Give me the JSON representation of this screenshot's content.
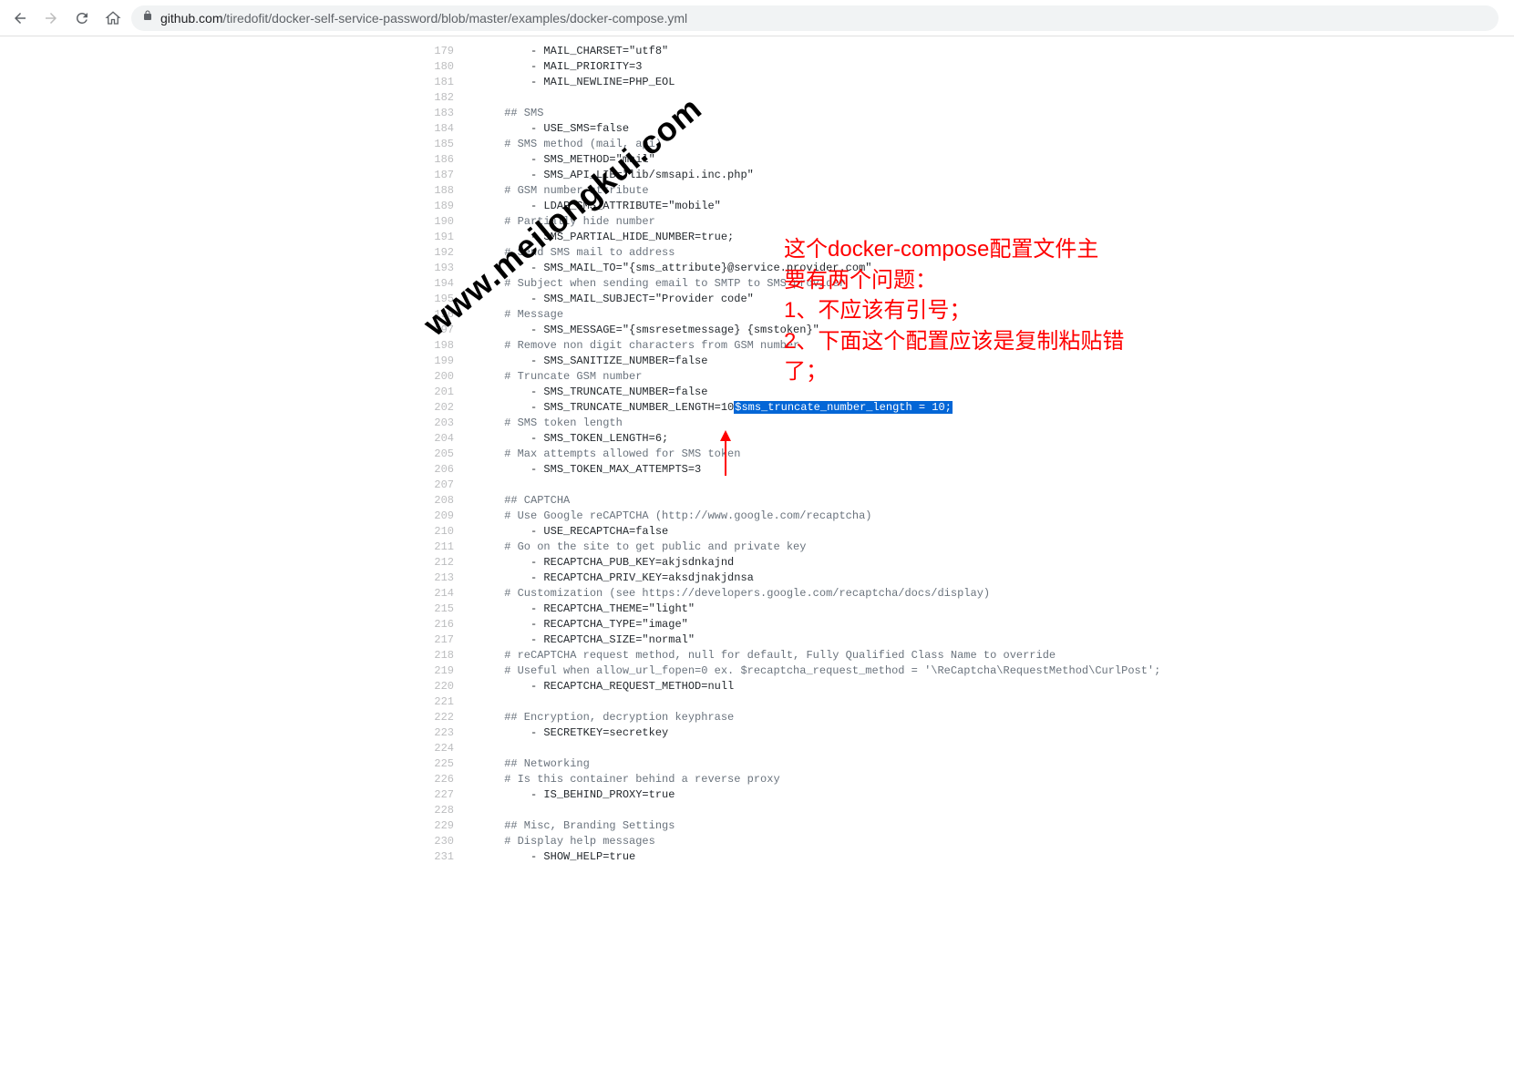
{
  "browser": {
    "url_domain": "github.com",
    "url_path": "/tiredofit/docker-self-service-password/blob/master/examples/docker-compose.yml"
  },
  "annotation": {
    "line1": "这个docker-compose配置文件主",
    "line2": "要有两个问题：",
    "line3": "1、不应该有引号；",
    "line4": "2、下面这个配置应该是复制粘贴错",
    "line5": "了；"
  },
  "watermark": "www.meilongkui.com",
  "code_lines": [
    {
      "n": 179,
      "indent": 10,
      "type": "plain",
      "text": "- MAIL_CHARSET=\"utf8\""
    },
    {
      "n": 180,
      "indent": 10,
      "type": "plain",
      "text": "- MAIL_PRIORITY=3"
    },
    {
      "n": 181,
      "indent": 10,
      "type": "plain",
      "text": "- MAIL_NEWLINE=PHP_EOL"
    },
    {
      "n": 182,
      "indent": 0,
      "type": "blank",
      "text": ""
    },
    {
      "n": 183,
      "indent": 6,
      "type": "comment",
      "text": "## SMS"
    },
    {
      "n": 184,
      "indent": 10,
      "type": "plain",
      "text": "- USE_SMS=false"
    },
    {
      "n": 185,
      "indent": 6,
      "type": "comment",
      "text": "# SMS method (mail, api)"
    },
    {
      "n": 186,
      "indent": 10,
      "type": "plain",
      "text": "- SMS_METHOD=\"mail\""
    },
    {
      "n": 187,
      "indent": 10,
      "type": "plain",
      "text": "- SMS_API_LIB=\"lib/smsapi.inc.php\""
    },
    {
      "n": 188,
      "indent": 6,
      "type": "comment",
      "text": "# GSM number attribute"
    },
    {
      "n": 189,
      "indent": 10,
      "type": "plain",
      "text": "- LDAP_SMS_ATTRIBUTE=\"mobile\""
    },
    {
      "n": 190,
      "indent": 6,
      "type": "comment",
      "text": "# Partially hide number"
    },
    {
      "n": 191,
      "indent": 10,
      "type": "plain",
      "text": "- SMS_PARTIAL_HIDE_NUMBER=true;"
    },
    {
      "n": 192,
      "indent": 6,
      "type": "comment",
      "text": "# Send SMS mail to address"
    },
    {
      "n": 193,
      "indent": 10,
      "type": "plain",
      "text": "- SMS_MAIL_TO=\"{sms_attribute}@service.provider.com\""
    },
    {
      "n": 194,
      "indent": 6,
      "type": "comment",
      "text": "# Subject when sending email to SMTP to SMS provider"
    },
    {
      "n": 195,
      "indent": 10,
      "type": "plain",
      "text": "- SMS_MAIL_SUBJECT=\"Provider code\""
    },
    {
      "n": 196,
      "indent": 6,
      "type": "comment",
      "text": "# Message"
    },
    {
      "n": 197,
      "indent": 10,
      "type": "plain",
      "text": "- SMS_MESSAGE=\"{smsresetmessage} {smstoken}\""
    },
    {
      "n": 198,
      "indent": 6,
      "type": "comment",
      "text": "# Remove non digit characters from GSM number"
    },
    {
      "n": 199,
      "indent": 10,
      "type": "plain",
      "text": "- SMS_SANITIZE_NUMBER=false"
    },
    {
      "n": 200,
      "indent": 6,
      "type": "comment",
      "text": "# Truncate GSM number"
    },
    {
      "n": 201,
      "indent": 10,
      "type": "plain",
      "text": "- SMS_TRUNCATE_NUMBER=false"
    },
    {
      "n": 202,
      "indent": 10,
      "type": "plain",
      "text": "- SMS_TRUNCATE_NUMBER_LENGTH=10",
      "hl": "$sms_truncate_number_length = 10;"
    },
    {
      "n": 203,
      "indent": 6,
      "type": "comment",
      "text": "# SMS token length"
    },
    {
      "n": 204,
      "indent": 10,
      "type": "plain",
      "text": "- SMS_TOKEN_LENGTH=6;"
    },
    {
      "n": 205,
      "indent": 6,
      "type": "comment",
      "text": "# Max attempts allowed for SMS token"
    },
    {
      "n": 206,
      "indent": 10,
      "type": "plain",
      "text": "- SMS_TOKEN_MAX_ATTEMPTS=3"
    },
    {
      "n": 207,
      "indent": 0,
      "type": "blank",
      "text": ""
    },
    {
      "n": 208,
      "indent": 6,
      "type": "comment",
      "text": "## CAPTCHA"
    },
    {
      "n": 209,
      "indent": 6,
      "type": "comment",
      "text": "# Use Google reCAPTCHA (http://www.google.com/recaptcha)"
    },
    {
      "n": 210,
      "indent": 10,
      "type": "plain",
      "text": "- USE_RECAPTCHA=false"
    },
    {
      "n": 211,
      "indent": 6,
      "type": "comment",
      "text": "# Go on the site to get public and private key"
    },
    {
      "n": 212,
      "indent": 10,
      "type": "plain",
      "text": "- RECAPTCHA_PUB_KEY=akjsdnkajnd"
    },
    {
      "n": 213,
      "indent": 10,
      "type": "plain",
      "text": "- RECAPTCHA_PRIV_KEY=aksdjnakjdnsa"
    },
    {
      "n": 214,
      "indent": 6,
      "type": "comment",
      "text": "# Customization (see https://developers.google.com/recaptcha/docs/display)"
    },
    {
      "n": 215,
      "indent": 10,
      "type": "plain",
      "text": "- RECAPTCHA_THEME=\"light\""
    },
    {
      "n": 216,
      "indent": 10,
      "type": "plain",
      "text": "- RECAPTCHA_TYPE=\"image\""
    },
    {
      "n": 217,
      "indent": 10,
      "type": "plain",
      "text": "- RECAPTCHA_SIZE=\"normal\""
    },
    {
      "n": 218,
      "indent": 6,
      "type": "comment",
      "text": "# reCAPTCHA request method, null for default, Fully Qualified Class Name to override"
    },
    {
      "n": 219,
      "indent": 6,
      "type": "comment",
      "text": "# Useful when allow_url_fopen=0 ex. $recaptcha_request_method = '\\ReCaptcha\\RequestMethod\\CurlPost';"
    },
    {
      "n": 220,
      "indent": 10,
      "type": "plain",
      "text": "- RECAPTCHA_REQUEST_METHOD=null"
    },
    {
      "n": 221,
      "indent": 0,
      "type": "blank",
      "text": ""
    },
    {
      "n": 222,
      "indent": 6,
      "type": "comment",
      "text": "## Encryption, decryption keyphrase"
    },
    {
      "n": 223,
      "indent": 10,
      "type": "plain",
      "text": "- SECRETKEY=secretkey"
    },
    {
      "n": 224,
      "indent": 0,
      "type": "blank",
      "text": ""
    },
    {
      "n": 225,
      "indent": 6,
      "type": "comment",
      "text": "## Networking"
    },
    {
      "n": 226,
      "indent": 6,
      "type": "comment",
      "text": "# Is this container behind a reverse proxy"
    },
    {
      "n": 227,
      "indent": 10,
      "type": "plain",
      "text": "- IS_BEHIND_PROXY=true"
    },
    {
      "n": 228,
      "indent": 0,
      "type": "blank",
      "text": ""
    },
    {
      "n": 229,
      "indent": 6,
      "type": "comment",
      "text": "## Misc, Branding Settings"
    },
    {
      "n": 230,
      "indent": 6,
      "type": "comment",
      "text": "# Display help messages"
    },
    {
      "n": 231,
      "indent": 10,
      "type": "plain",
      "text": "- SHOW_HELP=true"
    }
  ]
}
